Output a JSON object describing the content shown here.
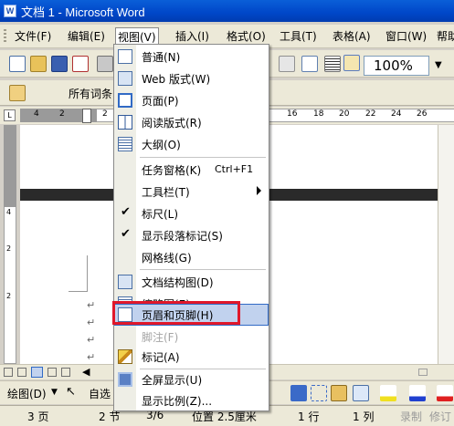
{
  "window": {
    "title": "文档 1 - Microsoft Word"
  },
  "menubar": {
    "items": [
      {
        "label": "文件(F)"
      },
      {
        "label": "编辑(E)"
      },
      {
        "label": "视图(V)"
      },
      {
        "label": "插入(I)"
      },
      {
        "label": "格式(O)"
      },
      {
        "label": "工具(T)"
      },
      {
        "label": "表格(A)"
      },
      {
        "label": "窗口(W)"
      },
      {
        "label": "帮助"
      }
    ]
  },
  "toolbar": {
    "zoom": "100%",
    "style_label": "所有词条"
  },
  "ruler": {
    "ticks": [
      "4",
      "2",
      "2",
      "16",
      "18",
      "20",
      "22",
      "24",
      "26"
    ]
  },
  "view_menu": {
    "items": [
      {
        "label": "普通(N)",
        "icon": "normal-view-icon"
      },
      {
        "label": "Web 版式(W)",
        "icon": "web-layout-icon"
      },
      {
        "label": "页面(P)",
        "icon": "print-layout-icon"
      },
      {
        "label": "阅读版式(R)",
        "icon": "reading-layout-icon"
      },
      {
        "label": "大纲(O)",
        "icon": "outline-icon"
      },
      {
        "label": "任务窗格(K)",
        "shortcut": "Ctrl+F1"
      },
      {
        "label": "工具栏(T)",
        "submenu": true
      },
      {
        "label": "标尺(L)",
        "checked": true
      },
      {
        "label": "显示段落标记(S)",
        "checked": true
      },
      {
        "label": "网格线(G)"
      },
      {
        "label": "文档结构图(D)",
        "icon": "document-map-icon"
      },
      {
        "label": "缩略图(E)",
        "icon": "thumbnails-icon"
      },
      {
        "label": "页眉和页脚(H)",
        "icon": "header-footer-icon",
        "highlighted": true
      },
      {
        "label": "脚注(F)",
        "disabled": true
      },
      {
        "label": "标记(A)",
        "icon": "markup-icon"
      },
      {
        "label": "全屏显示(U)",
        "icon": "full-screen-icon"
      },
      {
        "label": "显示比例(Z)..."
      }
    ]
  },
  "drawbar": {
    "draw_label": "绘图(D)",
    "autoshape_label": "自选"
  },
  "statusbar": {
    "page": "3 页",
    "section": "2 节",
    "page_of": "3/6",
    "position": "位置 2.5厘米",
    "line": "1 行",
    "column": "1 列",
    "rec": "录制",
    "trk": "修订"
  }
}
